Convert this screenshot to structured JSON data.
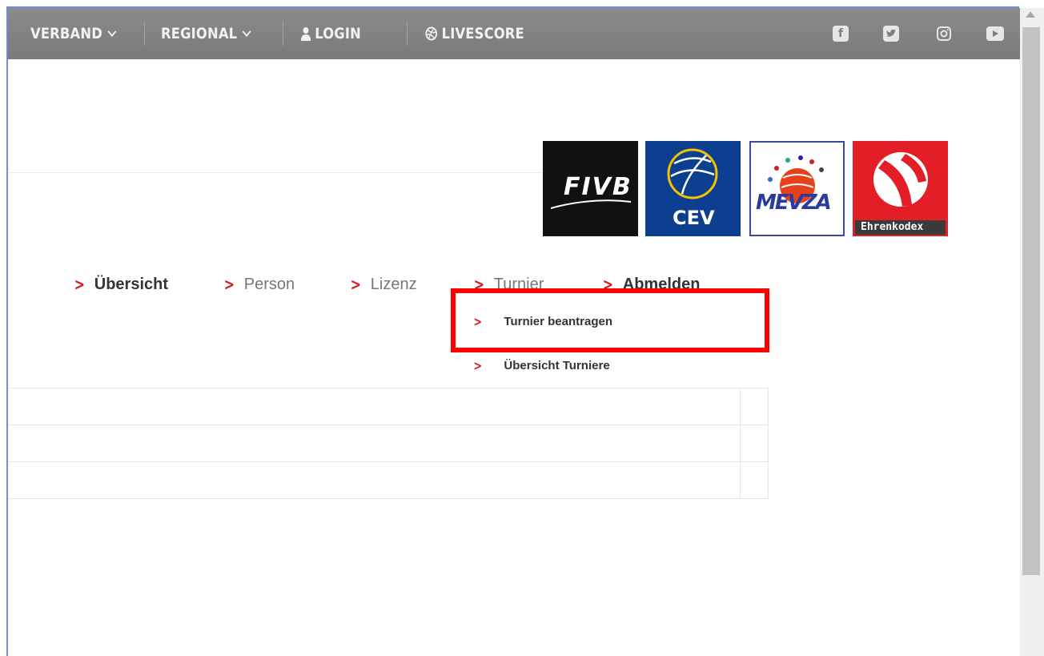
{
  "topnav": {
    "verband": "VERBAND",
    "regional": "REGIONAL",
    "login": "LOGIN",
    "livescore": "LIVESCORE",
    "social": [
      "facebook-icon",
      "twitter-icon",
      "instagram-icon",
      "youtube-icon"
    ]
  },
  "logos": {
    "fivb": "FIVB",
    "cev": "CEV",
    "mevza": "MEVZA",
    "ehrenkodex": "Ehrenkodex"
  },
  "subnav": {
    "items": [
      "Übersicht",
      "Person",
      "Lizenz",
      "Turnier",
      "Abmelden"
    ],
    "dropdown": [
      "Turnier beantragen",
      "Übersicht Turniere"
    ]
  },
  "colors": {
    "accent": "#d71920",
    "topbar": "#848484",
    "highlight": "#ff0000"
  }
}
